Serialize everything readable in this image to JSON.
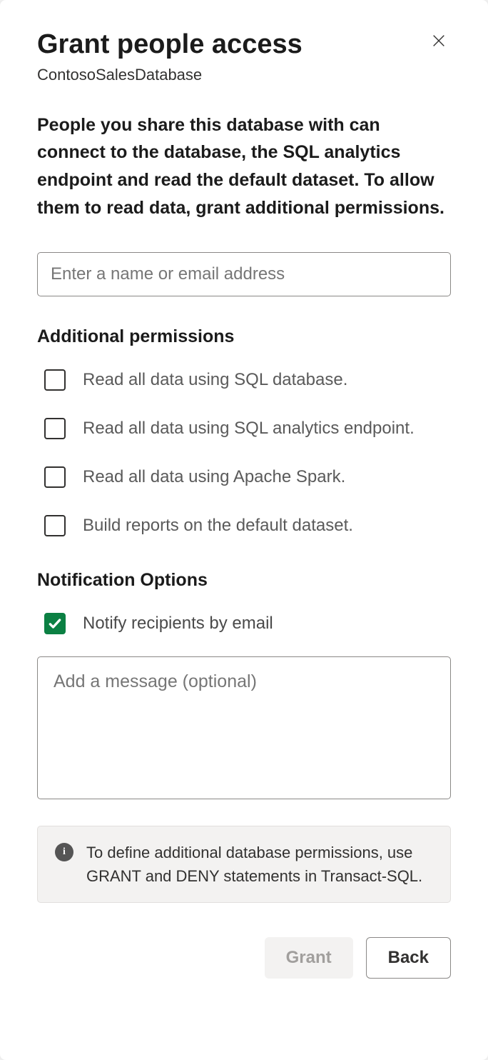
{
  "header": {
    "title": "Grant people access",
    "subtitle": "ContosoSalesDatabase"
  },
  "description": "People you share this database with can connect to the database, the SQL analytics endpoint and read the default dataset. To allow them to read data, grant additional permissions.",
  "nameInput": {
    "placeholder": "Enter a name or email address",
    "value": ""
  },
  "permissions": {
    "heading": "Additional permissions",
    "items": [
      {
        "label": "Read all data using SQL database.",
        "checked": false
      },
      {
        "label": "Read all data using SQL analytics endpoint.",
        "checked": false
      },
      {
        "label": "Read all data using Apache Spark.",
        "checked": false
      },
      {
        "label": "Build reports on the default dataset.",
        "checked": false
      }
    ]
  },
  "notification": {
    "heading": "Notification Options",
    "notifyLabel": "Notify recipients by email",
    "notifyChecked": true,
    "messagePlaceholder": "Add a message (optional)",
    "messageValue": ""
  },
  "infoBox": {
    "text": "To define additional database permissions, use GRANT and DENY statements in Transact-SQL."
  },
  "footer": {
    "grantLabel": "Grant",
    "backLabel": "Back"
  }
}
